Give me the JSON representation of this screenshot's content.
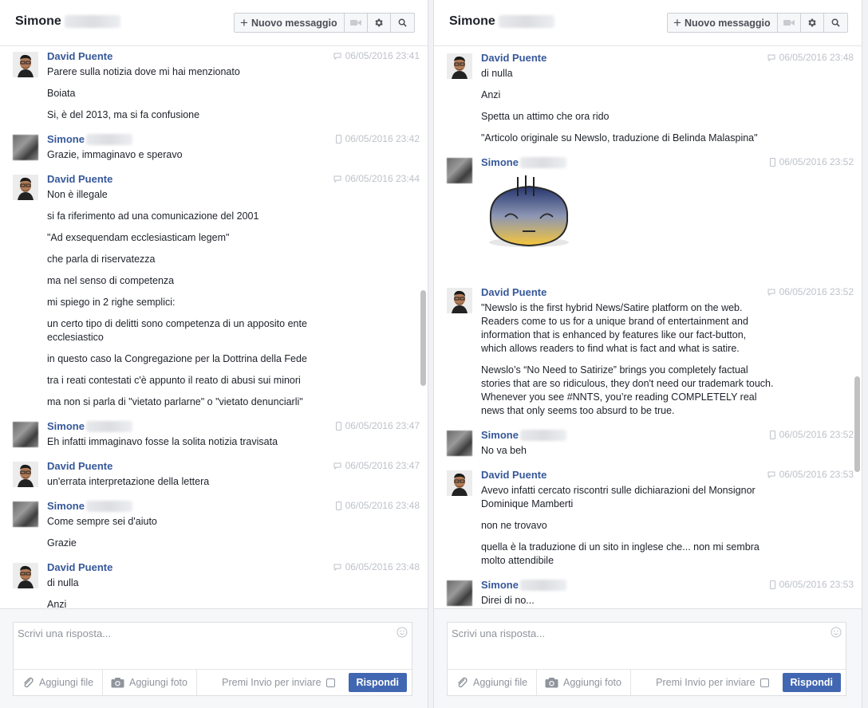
{
  "left": {
    "header": {
      "title": "Simone",
      "new_message": "Nuovo messaggio"
    },
    "messages": [
      {
        "sender": "David Puente",
        "time": "06/05/2016 23:41",
        "lines": [
          "Parere sulla notizia dove mi hai menzionato",
          "Boiata",
          "Si, è del 2013, ma si fa confusione"
        ]
      },
      {
        "sender": "Simone",
        "time": "06/05/2016 23:42",
        "lines": [
          "Grazie, immaginavo e speravo"
        ]
      },
      {
        "sender": "David Puente",
        "time": "06/05/2016 23:44",
        "lines": [
          "Non è illegale",
          "si fa riferimento ad una comunicazione del 2001",
          "\"Ad exsequendam ecclesiasticam legem\"",
          "che parla di riservatezza",
          "ma nel senso di competenza",
          "mi spiego in 2 righe semplici:",
          "un certo tipo di delitti sono competenza di un apposito ente ecclesiastico",
          "in questo caso la Congregazione per la Dottrina della Fede",
          "tra i reati contestati c'è appunto il reato di abusi sui minori",
          "ma non si parla di \"vietato parlarne\" o \"vietato denunciarli\""
        ]
      },
      {
        "sender": "Simone",
        "time": "06/05/2016 23:47",
        "lines": [
          "Eh infatti immaginavo fosse la solita notizia travisata"
        ]
      },
      {
        "sender": "David Puente",
        "time": "06/05/2016 23:47",
        "lines": [
          "un'errata interpretazione della lettera"
        ]
      },
      {
        "sender": "Simone",
        "time": "06/05/2016 23:48",
        "lines": [
          "Come sempre sei d'aiuto",
          "Grazie"
        ]
      },
      {
        "sender": "David Puente",
        "time": "06/05/2016 23:48",
        "lines": [
          "di nulla",
          "Anzi"
        ]
      }
    ],
    "reply": {
      "placeholder": "Scrivi una risposta...",
      "add_file": "Aggiungi file",
      "add_photo": "Aggiungi foto",
      "enter_to_send": "Premi Invio per inviare",
      "send": "Rispondi"
    }
  },
  "right": {
    "header": {
      "title": "Simone",
      "new_message": "Nuovo messaggio"
    },
    "messages": [
      {
        "sender": "David Puente",
        "time": "06/05/2016 23:48",
        "lines": [
          "di nulla",
          "Anzi",
          "Spetta un attimo che ora rido",
          "\"Articolo originale su Newslo, traduzione di Belinda Malaspina\""
        ]
      },
      {
        "sender": "Simone",
        "time": "06/05/2016 23:52",
        "lines": [],
        "sticker": "exasperated-face-sticker"
      },
      {
        "sender": "David Puente",
        "time": "06/05/2016 23:52",
        "lines": [
          "\"Newslo is the first hybrid News/Satire platform on the web. Readers come to us for a unique brand of entertainment and information that is enhanced by features like our fact-button, which allows readers to find what is fact and what is satire.",
          "Newslo’s “No Need to Satirize” brings you completely factual stories that are so ridiculous, they don't need our trademark touch. Whenever you see #NNTS, you’re reading COMPLETELY real news that only seems too absurd to be true."
        ]
      },
      {
        "sender": "Simone",
        "time": "06/05/2016 23:52",
        "lines": [
          "No va beh"
        ]
      },
      {
        "sender": "David Puente",
        "time": "06/05/2016 23:53",
        "lines": [
          "Avevo infatti cercato riscontri sulle dichiarazioni del Monsignor Dominique Mamberti",
          "non ne trovavo",
          "quella è la traduzione di un sito in inglese che... non mi sembra molto attendibile"
        ]
      },
      {
        "sender": "Simone",
        "time": "06/05/2016 23:53",
        "lines": [
          "Direi di no..."
        ]
      }
    ],
    "reply": {
      "placeholder": "Scrivi una risposta...",
      "add_file": "Aggiungi file",
      "add_photo": "Aggiungi foto",
      "enter_to_send": "Premi Invio per inviare",
      "send": "Rispondi"
    }
  },
  "colors": {
    "accent": "#4267b2",
    "sender_name": "#365899",
    "timestamp": "#bec2c9"
  }
}
